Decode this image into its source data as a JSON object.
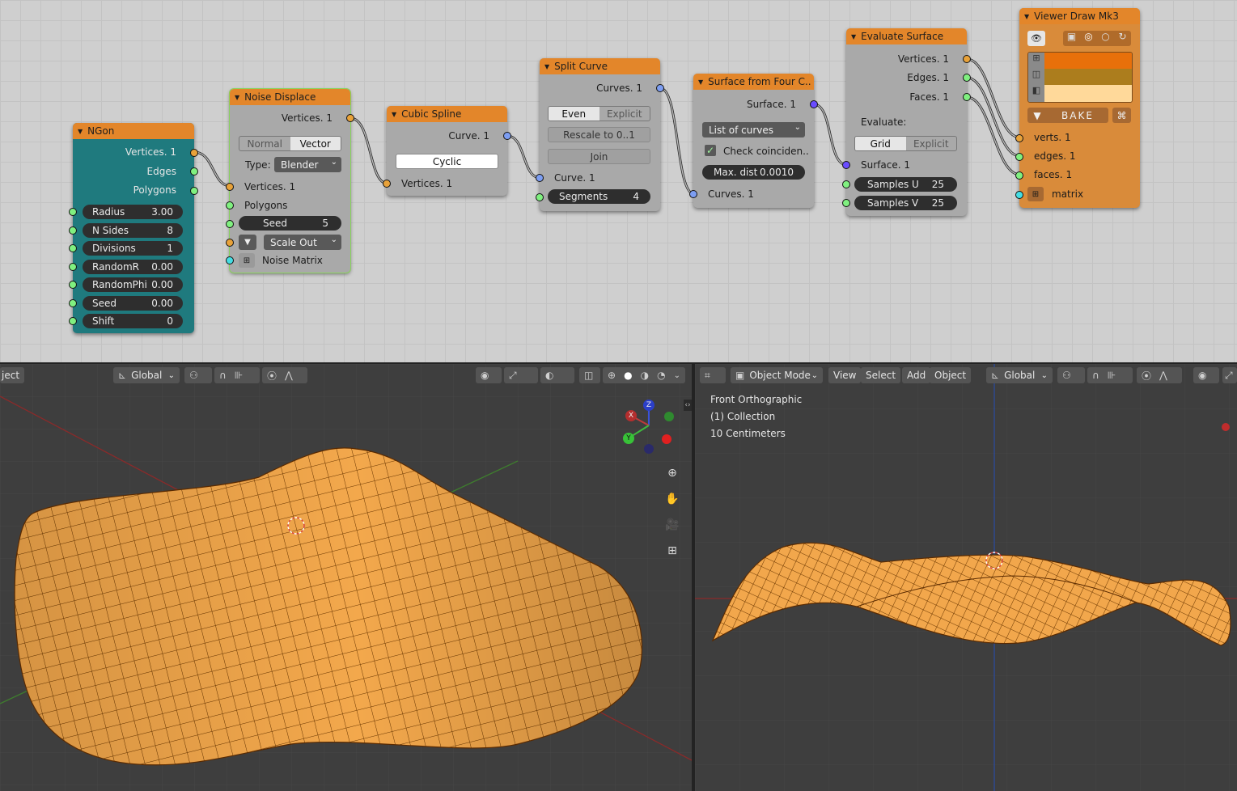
{
  "nodes": {
    "ngon": {
      "title": "NGon",
      "outputs": [
        "Vertices. 1",
        "Edges",
        "Polygons"
      ],
      "fields": [
        {
          "label": "Radius",
          "value": "3.00"
        },
        {
          "label": "N Sides",
          "value": "8"
        },
        {
          "label": "Divisions",
          "value": "1"
        },
        {
          "label": "RandomR",
          "value": "0.00"
        },
        {
          "label": "RandomPhi",
          "value": "0.00"
        },
        {
          "label": "Seed",
          "value": "0.00"
        },
        {
          "label": "Shift",
          "value": "0"
        }
      ]
    },
    "noise": {
      "title": "Noise Displace",
      "output": "Vertices. 1",
      "mode_options": [
        "Normal",
        "Vector"
      ],
      "mode_selected": "Vector",
      "type_label": "Type:",
      "type_value": "Blender",
      "inputs": [
        "Vertices. 1",
        "Polygons"
      ],
      "seed_label": "Seed",
      "seed_value": "5",
      "scale_value": "Scale Out",
      "matrix_label": "Noise Matrix"
    },
    "spline": {
      "title": "Cubic Spline",
      "output": "Curve. 1",
      "cyclic_label": "Cyclic",
      "input": "Vertices. 1"
    },
    "split": {
      "title": "Split Curve",
      "output": "Curves. 1",
      "mode_options": [
        "Even",
        "Explicit"
      ],
      "mode_selected": "Even",
      "rescale_label": "Rescale to 0..1",
      "join_label": "Join",
      "input": "Curve. 1",
      "segments_label": "Segments",
      "segments_value": "4"
    },
    "surface4": {
      "title": "Surface from Four C..",
      "output": "Surface. 1",
      "list_value": "List of curves",
      "check_label": "Check coinciden..",
      "maxdist_label": "Max. dist",
      "maxdist_value": "0.0010",
      "input": "Curves. 1"
    },
    "evaluate": {
      "title": "Evaluate Surface",
      "outputs": [
        "Vertices. 1",
        "Edges. 1",
        "Faces. 1"
      ],
      "evaluate_label": "Evaluate:",
      "mode_options": [
        "Grid",
        "Explicit"
      ],
      "mode_selected": "Grid",
      "input": "Surface. 1",
      "samples_u_label": "Samples U",
      "samples_u_value": "25",
      "samples_v_label": "Samples V",
      "samples_v_value": "25"
    },
    "viewer": {
      "title": "Viewer Draw Mk3",
      "bake_label": "BAKE",
      "inputs": [
        "verts. 1",
        "edges. 1",
        "faces. 1",
        "matrix"
      ],
      "colors": {
        "verts": "#e8700a",
        "edges": "#ac7d1d",
        "faces": "#ffd99a"
      }
    }
  },
  "viewport_left": {
    "mode_fragment": "ject",
    "orientation": "Global",
    "gizmo": {
      "x": "X",
      "y": "Y",
      "z": "Z"
    }
  },
  "viewport_right": {
    "mode": "Object Mode",
    "menus": [
      "View",
      "Select",
      "Add",
      "Object"
    ],
    "orientation": "Global",
    "overlay_lines": [
      "Front Orthographic",
      "(1) Collection",
      "10 Centimeters"
    ]
  },
  "colors": {
    "node_header": "#e3862a",
    "ngon_body": "#1f7a7e",
    "surface": "#f2a74c",
    "mesh_lines": "#5a2a00"
  }
}
